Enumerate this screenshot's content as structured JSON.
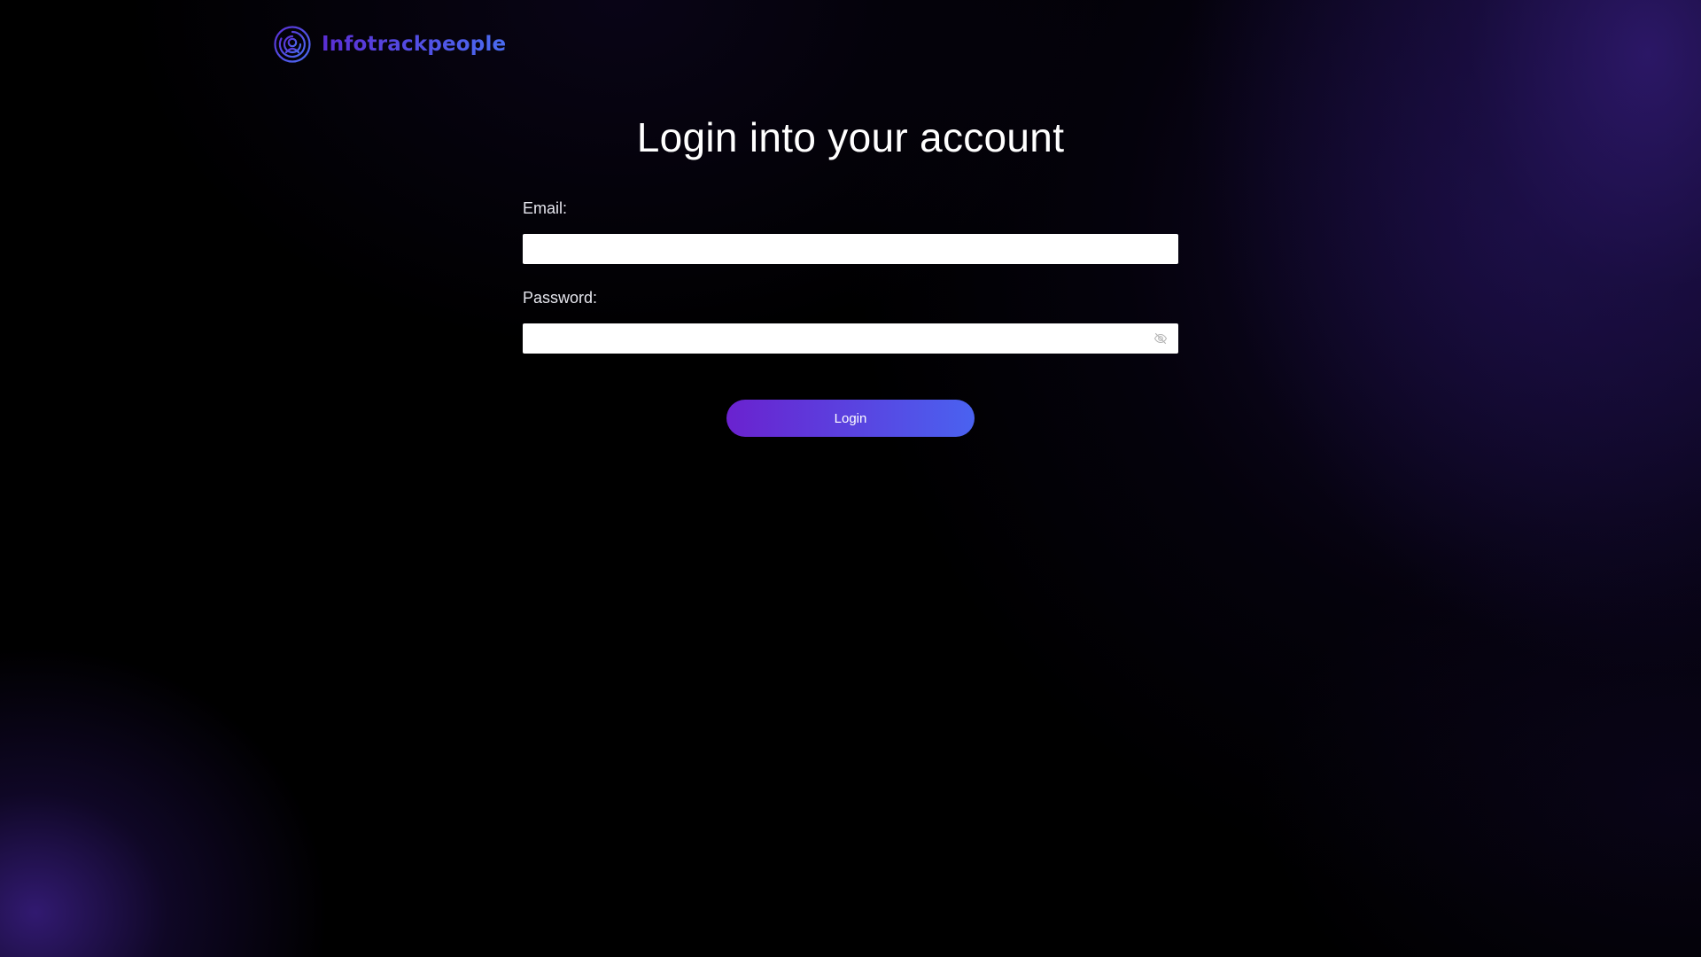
{
  "brand": {
    "name": "Infotrackpeople",
    "logo_icon": "concentric-circles-logo-icon",
    "colors": {
      "primary": "#5b2ed3",
      "secondary": "#4a6cf2"
    }
  },
  "page": {
    "title": "Login into your account"
  },
  "form": {
    "email_label": "Email:",
    "email_value": "",
    "password_label": "Password:",
    "password_value": "",
    "password_toggle_icon": "eye-off-icon",
    "submit_label": "Login"
  }
}
